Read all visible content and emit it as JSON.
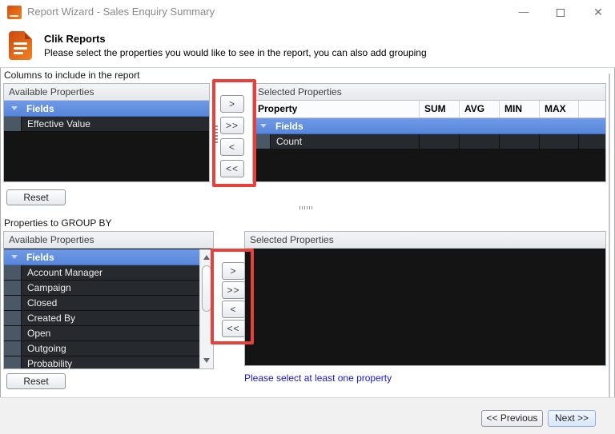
{
  "window": {
    "title": "Report Wizard - Sales Enquiry Summary",
    "minimize_glyph": "—",
    "close_glyph": "✕"
  },
  "header": {
    "title": "Clik Reports",
    "subtitle": "Please select the properties you would like to see in the report, you can also add grouping"
  },
  "columns_section": {
    "label": "Columns to include in the report",
    "available": {
      "caption": "Available Properties",
      "group": "Fields",
      "items": [
        "Effective Value"
      ]
    },
    "move_buttons": [
      ">",
      ">>",
      "<",
      "<<"
    ],
    "selected": {
      "caption": "Selected Properties",
      "table_headers": [
        "Property",
        "SUM",
        "AVG",
        "MIN",
        "MAX",
        ""
      ],
      "group": "Fields",
      "rows": [
        {
          "property": "Count",
          "sum": "",
          "avg": "",
          "min": "",
          "max": ""
        }
      ]
    },
    "reset_label": "Reset"
  },
  "group_section": {
    "label": "Properties to GROUP BY",
    "available": {
      "caption": "Available Properties",
      "group": "Fields",
      "items": [
        "Account Manager",
        "Campaign",
        "Closed",
        "Created By",
        "Open",
        "Outgoing",
        "Probability"
      ]
    },
    "move_buttons": [
      ">",
      ">>",
      "<",
      "<<"
    ],
    "selected": {
      "caption": "Selected Properties"
    },
    "validation_message": "Please select at least one property",
    "reset_label": "Reset"
  },
  "footer": {
    "previous_label": "<< Previous",
    "next_label": "Next >>"
  },
  "colors": {
    "group_row_blue": "#6191e2",
    "annotation_red": "#e8413c",
    "validation_blue": "#1414e0",
    "icon_orange": "#ef7c1e"
  }
}
